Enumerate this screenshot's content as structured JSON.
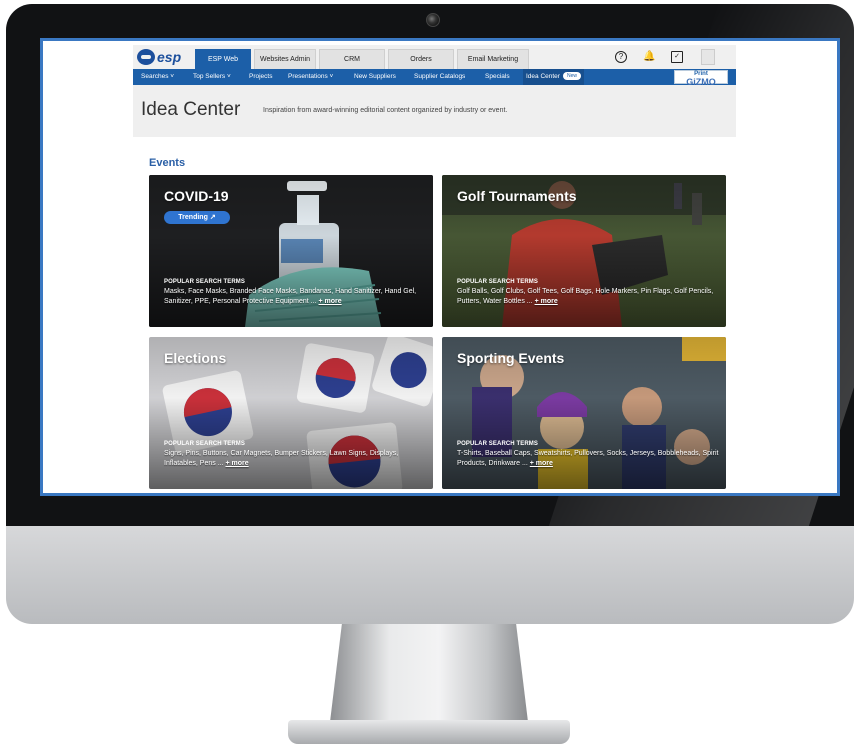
{
  "topbar": {
    "logo": "esp",
    "tabs": [
      {
        "label": "ESP Web",
        "active": true
      },
      {
        "label": "Websites Admin",
        "active": false
      },
      {
        "label": "CRM",
        "active": false
      },
      {
        "label": "Orders",
        "active": false
      },
      {
        "label": "Email Marketing",
        "active": false
      }
    ],
    "icons": [
      "help-icon",
      "bell-icon",
      "clipboard-icon",
      "avatar"
    ]
  },
  "subnav": {
    "items": [
      {
        "label": "Searches ˅"
      },
      {
        "label": "Top Sellers ˅"
      },
      {
        "label": "Projects"
      },
      {
        "label": "Presentations ˅"
      },
      {
        "label": "New Suppliers"
      },
      {
        "label": "Supplier Catalogs"
      },
      {
        "label": "Specials"
      },
      {
        "label": "Idea Center",
        "active": true,
        "badge": "New"
      }
    ],
    "partner_logo_top": "Print",
    "partner_logo_bottom": "GiZMO"
  },
  "banner": {
    "title": "Idea Center",
    "subtitle": "Inspiration from award-winning editorial content organized by industry or event."
  },
  "events": {
    "heading": "Events",
    "popular_label": "POPULAR SEARCH TERMS",
    "more_label": "+ more",
    "cards": [
      {
        "title": "COVID-19",
        "badge": "Trending",
        "terms": "Masks, Face Masks, Branded Face Masks, Bandanas, Hand Sanitizer, Hand Gel, Sanitizer, PPE, Personal Protective Equipment ..."
      },
      {
        "title": "Golf Tournaments",
        "terms": "Golf Balls, Golf Clubs, Golf Tees, Golf Bags, Hole Markers, Pin Flags, Golf Pencils, Putters, Water Bottles ..."
      },
      {
        "title": "Elections",
        "terms": "Signs, Pins, Buttons, Car Magnets, Bumper Stickers, Lawn Signs, Displays, Inflatables, Pens ..."
      },
      {
        "title": "Sporting Events",
        "terms": "T-Shirts, Baseball Caps, Sweatshirts, Pullovers, Socks, Jerseys, Bobbleheads, Spirit Products, Drinkware ..."
      }
    ]
  },
  "colors": {
    "brand_blue": "#1c5fa8",
    "heading_blue": "#2a5fa6",
    "trending_blue": "#2f74d0",
    "screen_border": "#3a78c2"
  }
}
